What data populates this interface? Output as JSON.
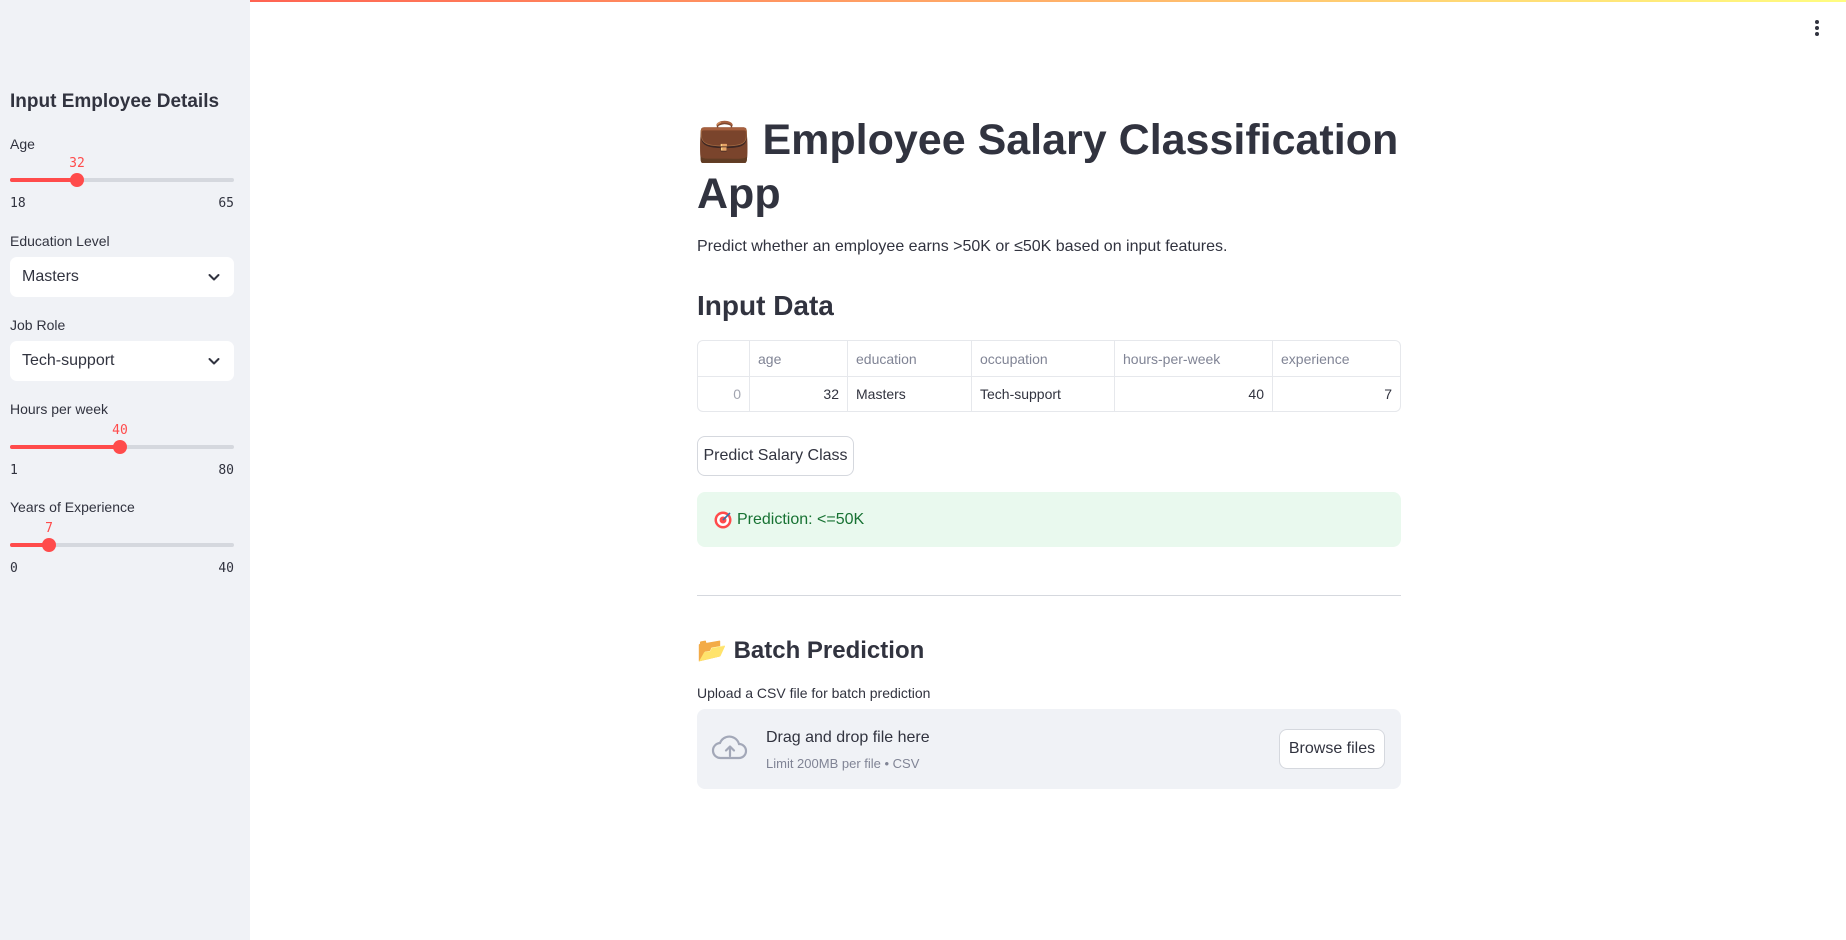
{
  "colors": {
    "accent": "#ff4b4b",
    "sidebar_bg": "#f0f2f6",
    "success_bg": "#e9f9ee",
    "success_text": "#177233"
  },
  "sidebar": {
    "title": "Input Employee Details",
    "age": {
      "label": "Age",
      "value": "32",
      "min": "18",
      "max": "65"
    },
    "education": {
      "label": "Education Level",
      "selected": "Masters"
    },
    "job_role": {
      "label": "Job Role",
      "selected": "Tech-support"
    },
    "hours": {
      "label": "Hours per week",
      "value": "40",
      "min": "1",
      "max": "80"
    },
    "experience": {
      "label": "Years of Experience",
      "value": "7",
      "min": "0",
      "max": "40"
    }
  },
  "main": {
    "title_icon": "💼",
    "title": "Employee Salary Classification App",
    "subtitle": "Predict whether an employee earns >50K or ≤50K based on input features.",
    "input_heading": "Input Data",
    "table": {
      "columns": [
        "",
        "age",
        "education",
        "occupation",
        "hours-per-week",
        "experience"
      ],
      "rows": [
        [
          "0",
          "32",
          "Masters",
          "Tech-support",
          "40",
          "7"
        ]
      ]
    },
    "predict_button": "Predict Salary Class",
    "prediction": "Prediction: <=50K",
    "batch_icon": "📂",
    "batch_heading": "Batch Prediction",
    "upload_label": "Upload a CSV file for batch prediction",
    "dropzone_title": "Drag and drop file here",
    "dropzone_hint": "Limit 200MB per file • CSV",
    "browse_button": "Browse files"
  },
  "icons": [
    "kebab-menu-icon",
    "chevron-down-icon",
    "target-icon",
    "cloud-upload-icon",
    "briefcase-icon",
    "folder-icon"
  ]
}
